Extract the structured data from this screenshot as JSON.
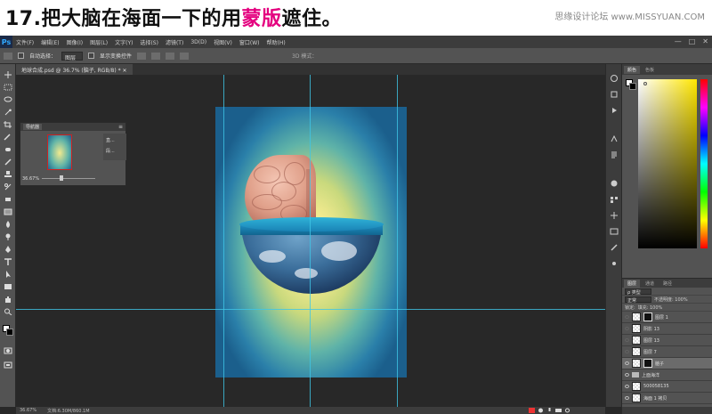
{
  "banner": {
    "title_prefix": "17.把大脑在海面一下的用",
    "title_highlight": "蒙版",
    "title_suffix": "遮住。",
    "site": "思缘设计论坛  www.MISSYUAN.COM"
  },
  "app": {
    "logo": "Ps",
    "menus": [
      "文件(F)",
      "编辑(E)",
      "图像(I)",
      "图层(L)",
      "文字(Y)",
      "选择(S)",
      "滤镜(T)",
      "3D(D)",
      "视图(V)",
      "窗口(W)",
      "帮助(H)"
    ],
    "window_controls": [
      "—",
      "□",
      "✕"
    ]
  },
  "options": {
    "auto_select_label": "自动选择：",
    "auto_select_value": "图层",
    "transform_label": "显示变换控件",
    "mode3d_label": "3D 模式："
  },
  "document": {
    "tab_label": "地球合成.psd @ 36.7% (脑子, RGB/8) *  ✕"
  },
  "navigator": {
    "tab": "导航器",
    "zoom": "36.67%",
    "side_items": [
      "直...",
      "段..."
    ]
  },
  "color_panel": {
    "tabs": [
      "颜色",
      "色板"
    ],
    "accent_hue": "#ffe600"
  },
  "layers_panel": {
    "tabs": [
      "图层",
      "通道",
      "路径"
    ],
    "filter_value": "ρ 类型",
    "blend_mode": "正常",
    "opacity_label": "不透明度: 100%",
    "lock_label": "锁定:",
    "fill_label": "填充: 100%",
    "layers": [
      {
        "name": "图层 1",
        "type": "layer",
        "mask": true,
        "visible": false,
        "selected": false
      },
      {
        "name": "阴影 13",
        "type": "layer",
        "mask": false,
        "visible": false,
        "selected": false
      },
      {
        "name": "图层 13",
        "type": "layer",
        "mask": false,
        "visible": false,
        "selected": false
      },
      {
        "name": "图层 7",
        "type": "layer",
        "mask": false,
        "visible": false,
        "selected": false
      },
      {
        "name": "脑子",
        "type": "layer",
        "mask": true,
        "visible": true,
        "selected": true
      },
      {
        "name": "上面海洋",
        "type": "group",
        "mask": false,
        "visible": true,
        "selected": false
      },
      {
        "name": "500058135",
        "type": "layer",
        "mask": false,
        "visible": true,
        "selected": false
      },
      {
        "name": "海面 1 拷贝",
        "type": "layer",
        "mask": false,
        "visible": true,
        "selected": false
      },
      {
        "name": "下面海洋",
        "type": "group",
        "mask": false,
        "visible": true,
        "selected": false
      }
    ]
  },
  "status": {
    "zoom": "36.67%",
    "doc_size": "文档:6.30M/860.1M"
  },
  "colors": {
    "guide": "#3fc6e6",
    "highlight": "#e4007f"
  }
}
